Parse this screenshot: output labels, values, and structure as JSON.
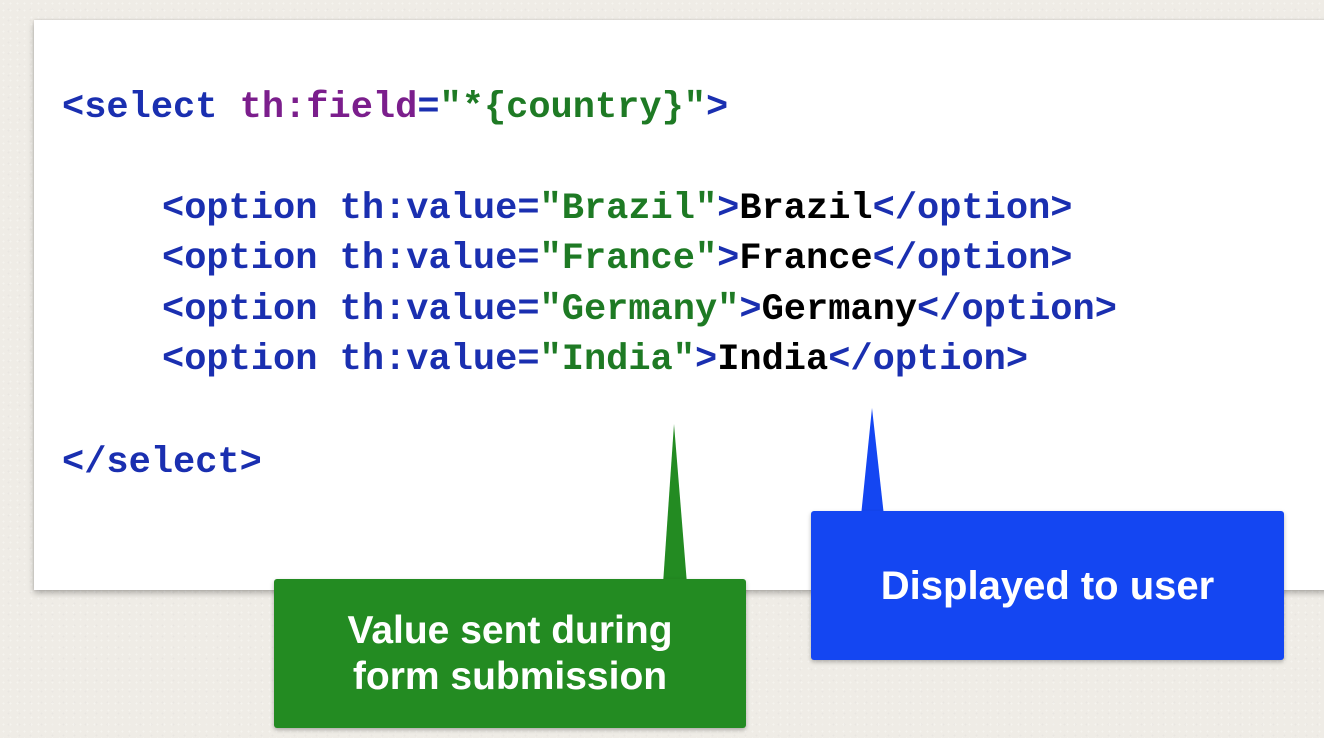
{
  "code": {
    "lines": [
      [
        {
          "t": "<",
          "k": "tag"
        },
        {
          "t": "select",
          "k": "tag"
        },
        {
          "t": " ",
          "k": "txt"
        },
        {
          "t": "th:field",
          "k": "attr"
        },
        {
          "t": "=",
          "k": "tag"
        },
        {
          "t": "\"*{country}\"",
          "k": "str"
        },
        {
          "t": ">",
          "k": "tag"
        }
      ],
      [
        {
          "t": "<",
          "k": "tag"
        },
        {
          "t": "option",
          "k": "tag"
        },
        {
          "t": " ",
          "k": "txt"
        },
        {
          "t": "th:value",
          "k": "tag"
        },
        {
          "t": "=",
          "k": "tag"
        },
        {
          "t": "\"Brazil\"",
          "k": "str"
        },
        {
          "t": ">",
          "k": "tag"
        },
        {
          "t": "Brazil",
          "k": "txt"
        },
        {
          "t": "</",
          "k": "tag"
        },
        {
          "t": "option",
          "k": "tag"
        },
        {
          "t": ">",
          "k": "tag"
        }
      ],
      [
        {
          "t": "<",
          "k": "tag"
        },
        {
          "t": "option",
          "k": "tag"
        },
        {
          "t": " ",
          "k": "txt"
        },
        {
          "t": "th:value",
          "k": "tag"
        },
        {
          "t": "=",
          "k": "tag"
        },
        {
          "t": "\"France\"",
          "k": "str"
        },
        {
          "t": ">",
          "k": "tag"
        },
        {
          "t": "France",
          "k": "txt"
        },
        {
          "t": "</",
          "k": "tag"
        },
        {
          "t": "option",
          "k": "tag"
        },
        {
          "t": ">",
          "k": "tag"
        }
      ],
      [
        {
          "t": "<",
          "k": "tag"
        },
        {
          "t": "option",
          "k": "tag"
        },
        {
          "t": " ",
          "k": "txt"
        },
        {
          "t": "th:value",
          "k": "tag"
        },
        {
          "t": "=",
          "k": "tag"
        },
        {
          "t": "\"Germany\"",
          "k": "str"
        },
        {
          "t": ">",
          "k": "tag"
        },
        {
          "t": "Germany",
          "k": "txt"
        },
        {
          "t": "</",
          "k": "tag"
        },
        {
          "t": "option",
          "k": "tag"
        },
        {
          "t": ">",
          "k": "tag"
        }
      ],
      [
        {
          "t": "<",
          "k": "tag"
        },
        {
          "t": "option",
          "k": "tag"
        },
        {
          "t": " ",
          "k": "txt"
        },
        {
          "t": "th:value",
          "k": "tag"
        },
        {
          "t": "=",
          "k": "tag"
        },
        {
          "t": "\"India\"",
          "k": "str"
        },
        {
          "t": ">",
          "k": "tag"
        },
        {
          "t": "India",
          "k": "txt"
        },
        {
          "t": "</",
          "k": "tag"
        },
        {
          "t": "option",
          "k": "tag"
        },
        {
          "t": ">",
          "k": "tag"
        }
      ],
      [
        {
          "t": "</",
          "k": "tag"
        },
        {
          "t": "select",
          "k": "tag"
        },
        {
          "t": ">",
          "k": "tag"
        }
      ]
    ]
  },
  "callouts": {
    "value": {
      "line1": "Value sent during",
      "line2": "form submission",
      "color": "#238b22"
    },
    "display": {
      "text": "Displayed to user",
      "color": "#1446f2"
    }
  },
  "colors": {
    "tag": "#1a2fb0",
    "attr": "#7b1e8c",
    "string": "#1e7a24",
    "text": "#000000"
  }
}
